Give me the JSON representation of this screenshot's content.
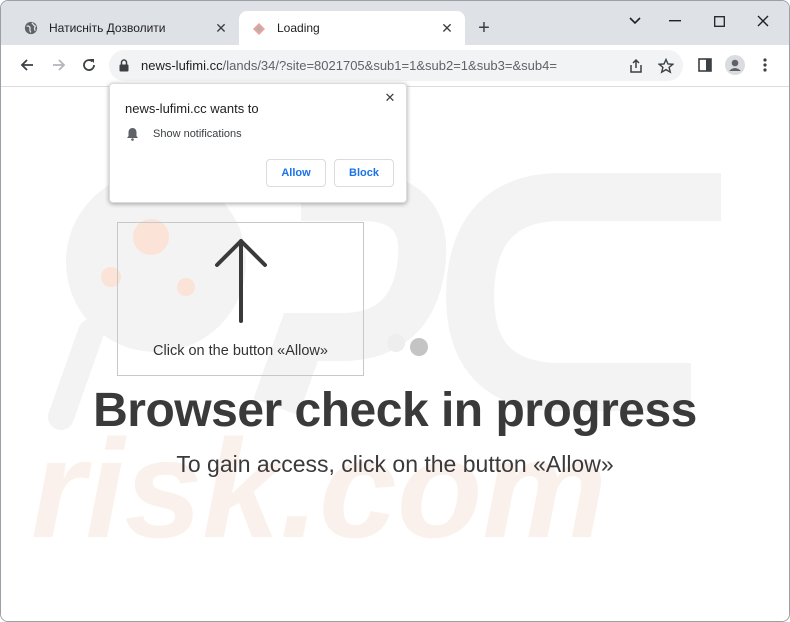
{
  "tabs": [
    {
      "title": "Натисніть Дозволити",
      "favicon": "globe-icon",
      "active": false
    },
    {
      "title": "Loading",
      "favicon": "loading-favicon-icon",
      "active": true
    }
  ],
  "address_bar": {
    "host": "news-lufimi.cc",
    "path": "/lands/34/?site=8021705&sub1=1&sub2=1&sub3=&sub4="
  },
  "permission_popup": {
    "title": "news-lufimi.cc wants to",
    "permission": "Show notifications",
    "allow_label": "Allow",
    "block_label": "Block"
  },
  "page": {
    "hint": "Click on the button «Allow»",
    "headline": "Browser check in progress",
    "subline": "To gain access, click on the button «Allow»"
  },
  "colors": {
    "titlebar": "#dee1e6",
    "accent": "#1a73e8",
    "text_dark": "#3a3a3a",
    "watermark": "#f7ede7"
  }
}
